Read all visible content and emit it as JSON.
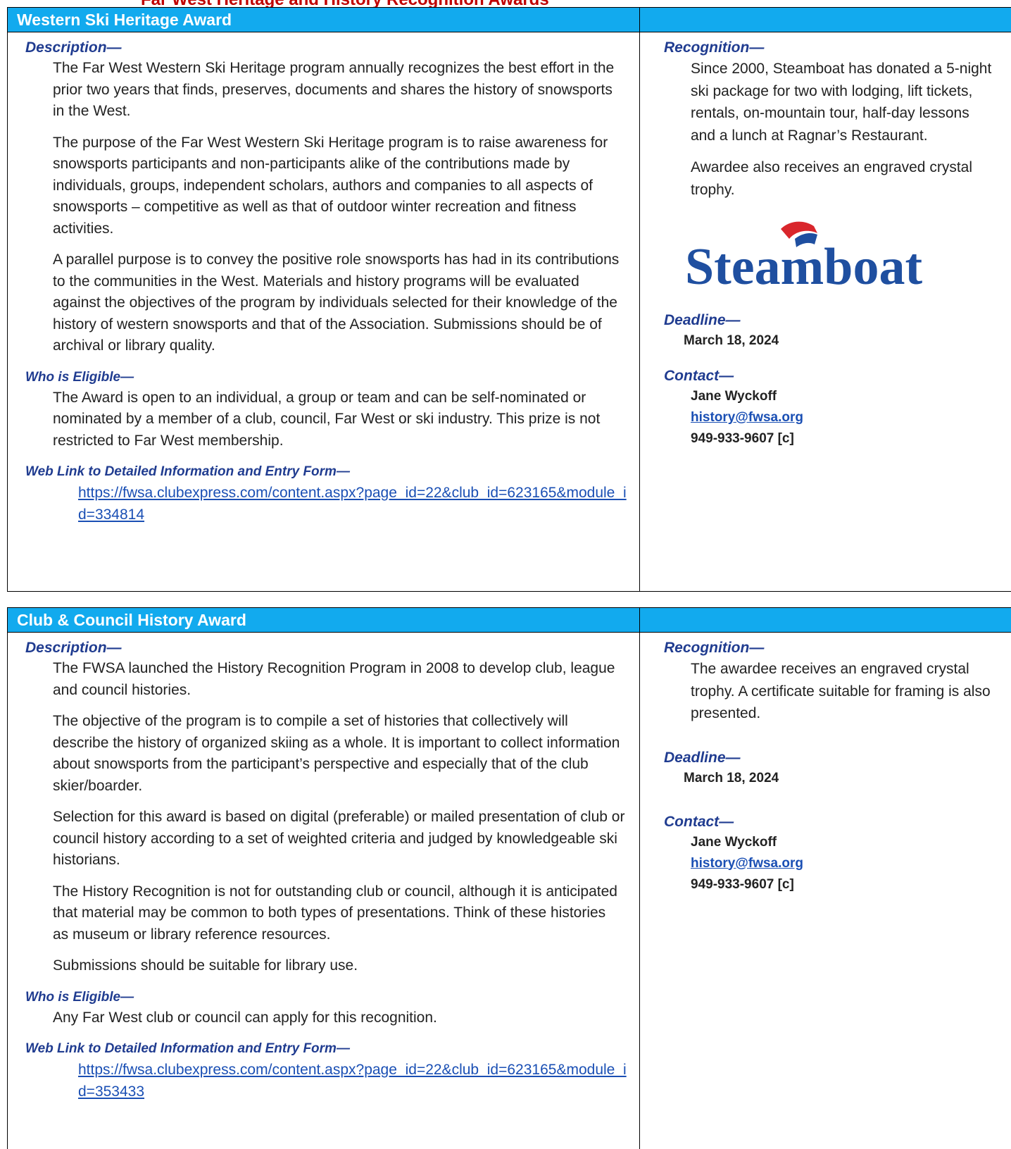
{
  "page_heading": "Far West Heritage and History Recognition Awards",
  "awards": [
    {
      "title": "Western Ski Heritage Award",
      "description_label": "Description—",
      "description": [
        "The Far West Western Ski Heritage program annually recognizes the best effort in the prior two years that finds, preserves, documents and shares the history of snowsports in the West.",
        "The purpose of the Far West Western Ski Heritage program is to raise awareness for snowsports participants and non-participants alike of the contributions made by individuals, groups, independent scholars, authors and companies to all aspects of snowsports – competitive as well as that of outdoor winter recreation and fitness activities.",
        "A parallel purpose is to convey the positive role snowsports has had in its contributions to the communities in the West.  Materials and history programs will be evaluated against the objectives of the program by individuals selected for their knowledge of the history of western snowsports and that of the Association. Submissions should be of archival or library quality."
      ],
      "eligible_label": "Who is Eligible—",
      "eligible": "The Award is open to an individual, a group or team and can be self-nominated or nominated by a member of a club, council, Far West or ski industry. This prize is not restricted to Far West membership.",
      "weblink_label": "Web Link to Detailed Information and Entry Form—",
      "weblink": "https://fwsa.clubexpress.com/content.aspx?page_id=22&club_id=623165&module_id=334814",
      "recognition_label": "Recognition—",
      "recognition": [
        "Since 2000, Steamboat has donated a 5-night ski package for two with lodging, lift tickets, rentals, on-mountain tour, half-day lessons and a lunch at Ragnar’s Restaurant.",
        "Awardee also receives an engraved crystal trophy."
      ],
      "logo_text": "Steamboat",
      "deadline_label": "Deadline—",
      "deadline": "March 18, 2024",
      "contact_label": "Contact—",
      "contact_name": "Jane Wyckoff",
      "contact_email": "history@fwsa.org",
      "contact_phone": "949-933-9607  [c]"
    },
    {
      "title": "Club & Council History Award",
      "description_label": "Description—",
      "description": [
        "The FWSA launched the History Recognition Program in 2008 to develop club, league and council histories.",
        "The objective of the program is to compile a set of histories that collectively will describe the history of organized skiing as a whole.  It is important to collect information about snowsports from the participant’s perspective and especially that of the club skier/boarder.",
        "Selection for this award is based on digital (preferable) or mailed presentation of club or council history according to a set of weighted criteria and judged by knowledgeable ski historians.",
        "The History Recognition is not for outstanding club or council, although it is anticipated that material may be common to both types of presentations. Think of these histories as museum or library reference resources.",
        "Submissions should be suitable for library use."
      ],
      "eligible_label": "Who is Eligible—",
      "eligible": "Any Far West club or council can apply for this recognition.",
      "weblink_label": "Web Link to Detailed Information and Entry Form—",
      "weblink": "https://fwsa.clubexpress.com/content.aspx?page_id=22&club_id=623165&module_id=353433",
      "recognition_label": "Recognition—",
      "recognition": [
        "The awardee receives an engraved crystal trophy.   A certificate suitable for framing is also presented."
      ],
      "deadline_label": "Deadline—",
      "deadline": "March 18, 2024",
      "contact_label": "Contact—",
      "contact_name": "Jane Wyckoff",
      "contact_email": "history@fwsa.org",
      "contact_phone": "949-933-9607  [c]"
    }
  ],
  "colors": {
    "header_bg": "#12aaee",
    "section_label": "#203c90",
    "link": "#1a4fb4",
    "logo_blue": "#1f4fa0",
    "logo_red": "#d9262c"
  }
}
